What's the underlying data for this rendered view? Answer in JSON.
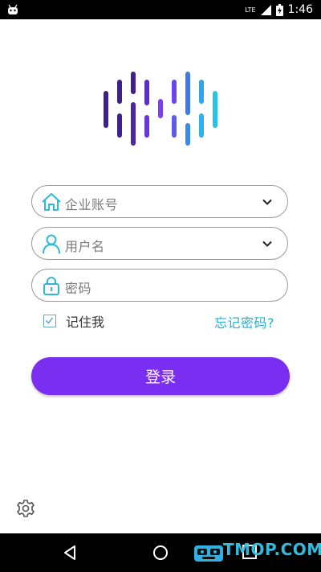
{
  "status_bar": {
    "time": "1:46",
    "network": "LTE"
  },
  "logo": {
    "colors": {
      "purple_dark": "#3e1f8c",
      "purple": "#7b3ff0",
      "blue": "#3a7fe8",
      "cyan": "#24c4ec"
    }
  },
  "form": {
    "company_placeholder": "企业账号",
    "username_placeholder": "用户名",
    "password_placeholder": "密码",
    "remember_label": "记住我",
    "remember_checked": true,
    "forgot_label": "忘记密码?",
    "login_label": "登录"
  },
  "colors": {
    "accent": "#7a2ef2",
    "link": "#1fb3d6",
    "icon": "#2fb8d8"
  },
  "watermark": "TMOP.COM"
}
